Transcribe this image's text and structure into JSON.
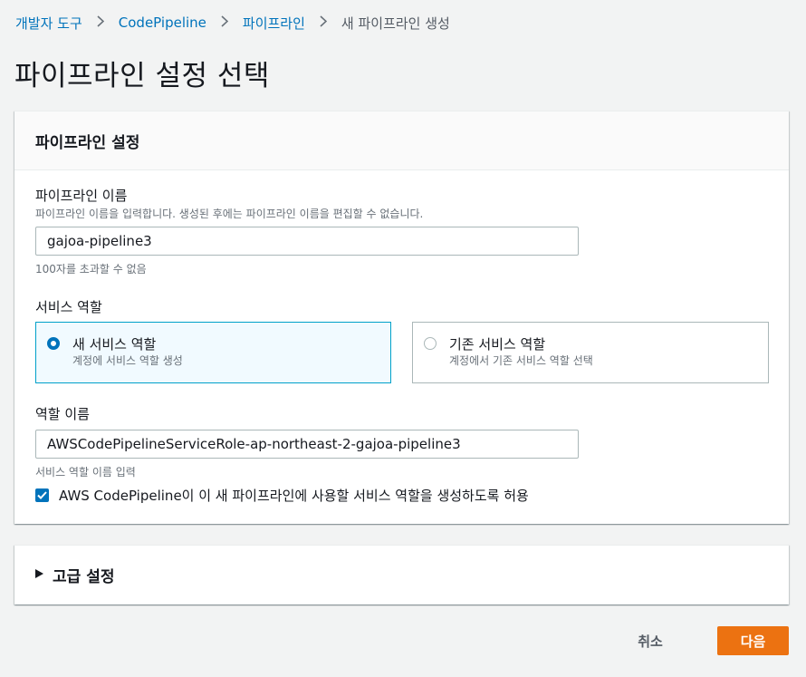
{
  "breadcrumb": {
    "items": [
      "개발자 도구",
      "CodePipeline",
      "파이프라인"
    ],
    "current": "새 파이프라인 생성"
  },
  "page_title": "파이프라인 설정 선택",
  "settings": {
    "header": "파이프라인 설정",
    "pipeline_name": {
      "label": "파이프라인 이름",
      "description": "파이프라인 이름을 입력합니다. 생성된 후에는 파이프라인 이름을 편집할 수 없습니다.",
      "value": "gajoa-pipeline3",
      "constraint": "100자를 초과할 수 없음"
    },
    "service_role": {
      "label": "서비스 역할",
      "options": [
        {
          "title": "새 서비스 역할",
          "desc": "계정에 서비스 역할 생성",
          "selected": true
        },
        {
          "title": "기존 서비스 역할",
          "desc": "계정에서 기존 서비스 역할 선택",
          "selected": false
        }
      ]
    },
    "role_name": {
      "label": "역할 이름",
      "value": "AWSCodePipelineServiceRole-ap-northeast-2-gajoa-pipeline3",
      "hint": "서비스 역할 이름 입력"
    },
    "allow_checkbox": {
      "label": "AWS CodePipeline이 이 새 파이프라인에 사용할 서비스 역할을 생성하도록 허용",
      "checked": true
    }
  },
  "advanced": {
    "label": "고급 설정"
  },
  "footer": {
    "cancel_label": "취소",
    "next_label": "다음"
  },
  "colors": {
    "link": "#0073bb",
    "primary_button": "#ec7211",
    "selected_tile_border": "#00a1c9",
    "selected_tile_bg": "#f1faff"
  }
}
